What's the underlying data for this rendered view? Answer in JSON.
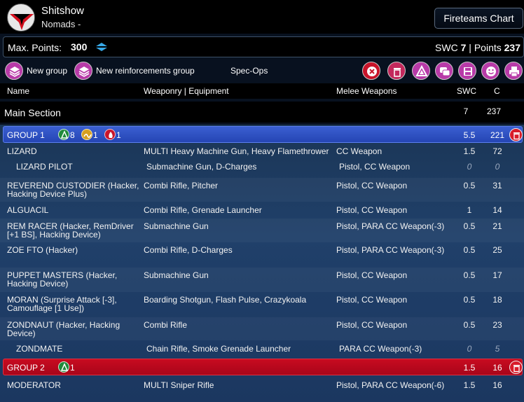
{
  "header": {
    "army_name": "Shitshow",
    "army_sub": "Nomads -",
    "fireteams_label": "Fireteams Chart"
  },
  "points": {
    "max_label": "Max. Points:",
    "max_value": "300",
    "swc_label": "SWC",
    "swc_value": "7",
    "separator": "|",
    "points_label": "Points",
    "points_value": "237"
  },
  "toolbar": {
    "new_group": "New group",
    "new_reinforcements": "New reinforcements group",
    "spec_ops": "Spec-Ops"
  },
  "columns": {
    "name": "Name",
    "weaponry": "Weaponry | Equipment",
    "melee": "Melee Weapons",
    "swc": "SWC",
    "cost": "C"
  },
  "main_section": {
    "title": "Main Section",
    "swc": "7",
    "points": "237"
  },
  "groups": [
    {
      "name": "GROUP 1",
      "counts": [
        "8",
        "1",
        "1"
      ],
      "swc": "5.5",
      "points": "221"
    },
    {
      "name": "GROUP 2",
      "counts": [
        "1"
      ],
      "swc": "1.5",
      "points": "16"
    }
  ],
  "rows": [
    {
      "name": "LIZARD",
      "weapons": "MULTI Heavy Machine Gun, Heavy Flamethrower",
      "melee": "CC Weapon",
      "swc": "1.5",
      "cost": "72"
    },
    {
      "name": "LIZARD PILOT",
      "weapons": "Submachine Gun, D-Charges",
      "melee": "Pistol, CC Weapon",
      "swc": "0",
      "cost": "0"
    },
    {
      "name": "REVEREND CUSTODIER (Hacker, Hacking Device Plus)",
      "weapons": "Combi Rifle, Pitcher",
      "melee": "Pistol, CC Weapon",
      "swc": "0.5",
      "cost": "31"
    },
    {
      "name": "ALGUACIL",
      "weapons": "Combi Rifle, Grenade Launcher",
      "melee": "Pistol, CC Weapon",
      "swc": "1",
      "cost": "14"
    },
    {
      "name": "REM RACER (Hacker, RemDriver [+1 BS], Hacking Device)",
      "weapons": "Submachine Gun",
      "melee": "Pistol, PARA CC Weapon(-3)",
      "swc": "0.5",
      "cost": "21"
    },
    {
      "name": "ZOE FTO (Hacker)",
      "weapons": "Combi Rifle, D-Charges",
      "melee": "Pistol, PARA CC Weapon(-3)",
      "swc": "0.5",
      "cost": "25"
    },
    {
      "name": "PUPPET MASTERS (Hacker, Hacking Device)",
      "weapons": "Submachine Gun",
      "melee": "Pistol, CC Weapon",
      "swc": "0.5",
      "cost": "17"
    },
    {
      "name": "MORAN (Surprise Attack [-3], Camouflage [1 Use])",
      "weapons": "Boarding Shotgun, Flash Pulse, Crazykoala",
      "melee": "Pistol, CC Weapon",
      "swc": "0.5",
      "cost": "18"
    },
    {
      "name": "ZONDNAUT (Hacker, Hacking Device)",
      "weapons": "Combi Rifle",
      "melee": "Pistol, CC Weapon",
      "swc": "0.5",
      "cost": "23"
    },
    {
      "name": "ZONDMATE",
      "weapons": "Chain Rifle, Smoke Grenade Launcher",
      "melee": "PARA CC Weapon(-3)",
      "swc": "0",
      "cost": "5"
    },
    {
      "name": "MODERATOR",
      "weapons": "MULTI Sniper Rifle",
      "melee": "Pistol, PARA CC Weapon(-6)",
      "swc": "1.5",
      "cost": "16"
    }
  ],
  "colors": {
    "group_blue": "#2c4fc0",
    "group_red": "#b8081d",
    "accent_red": "#d81b2a",
    "list_bg": "#1e3c63"
  },
  "icons": [
    "nomads-logo-icon",
    "spinner-arrows-icon",
    "new-group-icon",
    "new-reinforcements-icon",
    "delete-list-icon",
    "trash-icon",
    "spec-ops-icon",
    "chat-icon",
    "save-icon",
    "smiley-icon",
    "print-icon",
    "order-regular-icon",
    "order-irregular-icon",
    "order-impetuous-icon"
  ]
}
